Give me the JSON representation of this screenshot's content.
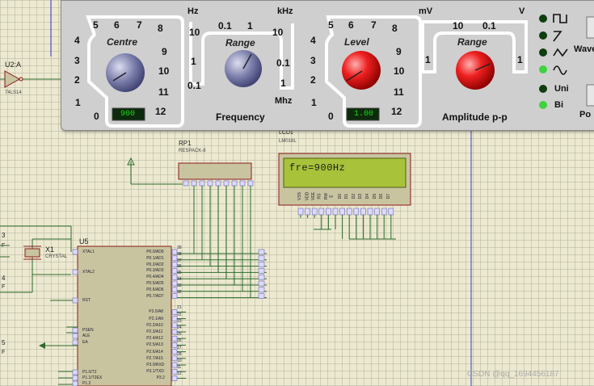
{
  "generator": {
    "centre": {
      "label": "Centre",
      "scale": [
        "5",
        "6",
        "7",
        "8",
        "9",
        "10",
        "11",
        "12",
        "0",
        "1",
        "2",
        "3",
        "4"
      ],
      "display": "900"
    },
    "range_freq": {
      "label": "Range",
      "scale_top": [
        "0.1",
        "1",
        "10"
      ],
      "scale_left": [
        "10",
        "1",
        "0.1"
      ],
      "scale_right": [
        "0.1",
        "1"
      ],
      "unit_hz": "Hz",
      "unit_khz": "kHz",
      "unit_mhz": "Mhz"
    },
    "frequency_label": "Frequency",
    "level": {
      "label": "Level",
      "scale": [
        "5",
        "6",
        "7",
        "8",
        "9",
        "10",
        "11",
        "12",
        "0",
        "1",
        "2",
        "3",
        "4"
      ],
      "display": "1.00"
    },
    "range_amp": {
      "label": "Range",
      "scale_top": [
        "10",
        "0.1"
      ],
      "scale_left": "1",
      "scale_right": "1",
      "unit_mv": "mV",
      "unit_v": "V"
    },
    "amplitude_label": "Amplitude p-p",
    "wave_label": "Wave",
    "polarity_label": "Po",
    "uni_label": "Uni",
    "bi_label": "Bi"
  },
  "schematic": {
    "u2_label": "U2:A",
    "u2_part": "74LS14",
    "rp1_label": "RP1",
    "rp1_part": "RESPACK-8",
    "lcd_ref": "LCD1",
    "lcd_part": "LM016L",
    "lcd_text": "fre=900Hz",
    "lcd_pins": [
      "VSS",
      "VDD",
      "VEE",
      "RS",
      "RW",
      "E",
      "D0",
      "D1",
      "D2",
      "D3",
      "D4",
      "D5",
      "D6",
      "D7"
    ],
    "x1_label": "X1",
    "x1_part": "CRYSTAL",
    "u5_label": "U5",
    "u5_left_pins": [
      "XTAL1",
      "XTAL2",
      "RST",
      "PSEN",
      "ALE",
      "EA",
      "P1.0/T2",
      "P1.1/T2EX",
      "P1.2"
    ],
    "u5_right_pins": [
      "P0.0/AD0",
      "P0.1/AD1",
      "P0.2/AD2",
      "P0.3/AD3",
      "P0.4/AD4",
      "P0.5/AD5",
      "P0.6/AD6",
      "P0.7/AD7",
      "P2.0/A8",
      "P2.1/A9",
      "P2.2/A10",
      "P2.3/A11",
      "P2.4/A12",
      "P2.5/A13",
      "P2.6/A14",
      "P2.7/A15",
      "P3.0/RXD",
      "P3.1/TXD",
      "P3.2"
    ],
    "pin_numbers_right": [
      "39",
      "38",
      "37",
      "36",
      "35",
      "34",
      "33",
      "32",
      "21",
      "22",
      "23",
      "24",
      "25",
      "26",
      "27",
      "28",
      "10",
      "11",
      "12"
    ],
    "left_fragments": [
      "3",
      "F",
      "4",
      "F",
      "5",
      "F"
    ],
    "watermark": "CSDN @qq_1694456187"
  },
  "colors": {
    "knob_blue": "#6c6f9c",
    "knob_red": "#e81a1a",
    "led_green": "#1f9e1f",
    "led_dark": "#0f3d0f",
    "lcd_bg": "#a8c23a",
    "wire_green": "#2d6b2d",
    "chip_fill": "#c9c4a0",
    "chip_border": "#8b1a1a"
  }
}
